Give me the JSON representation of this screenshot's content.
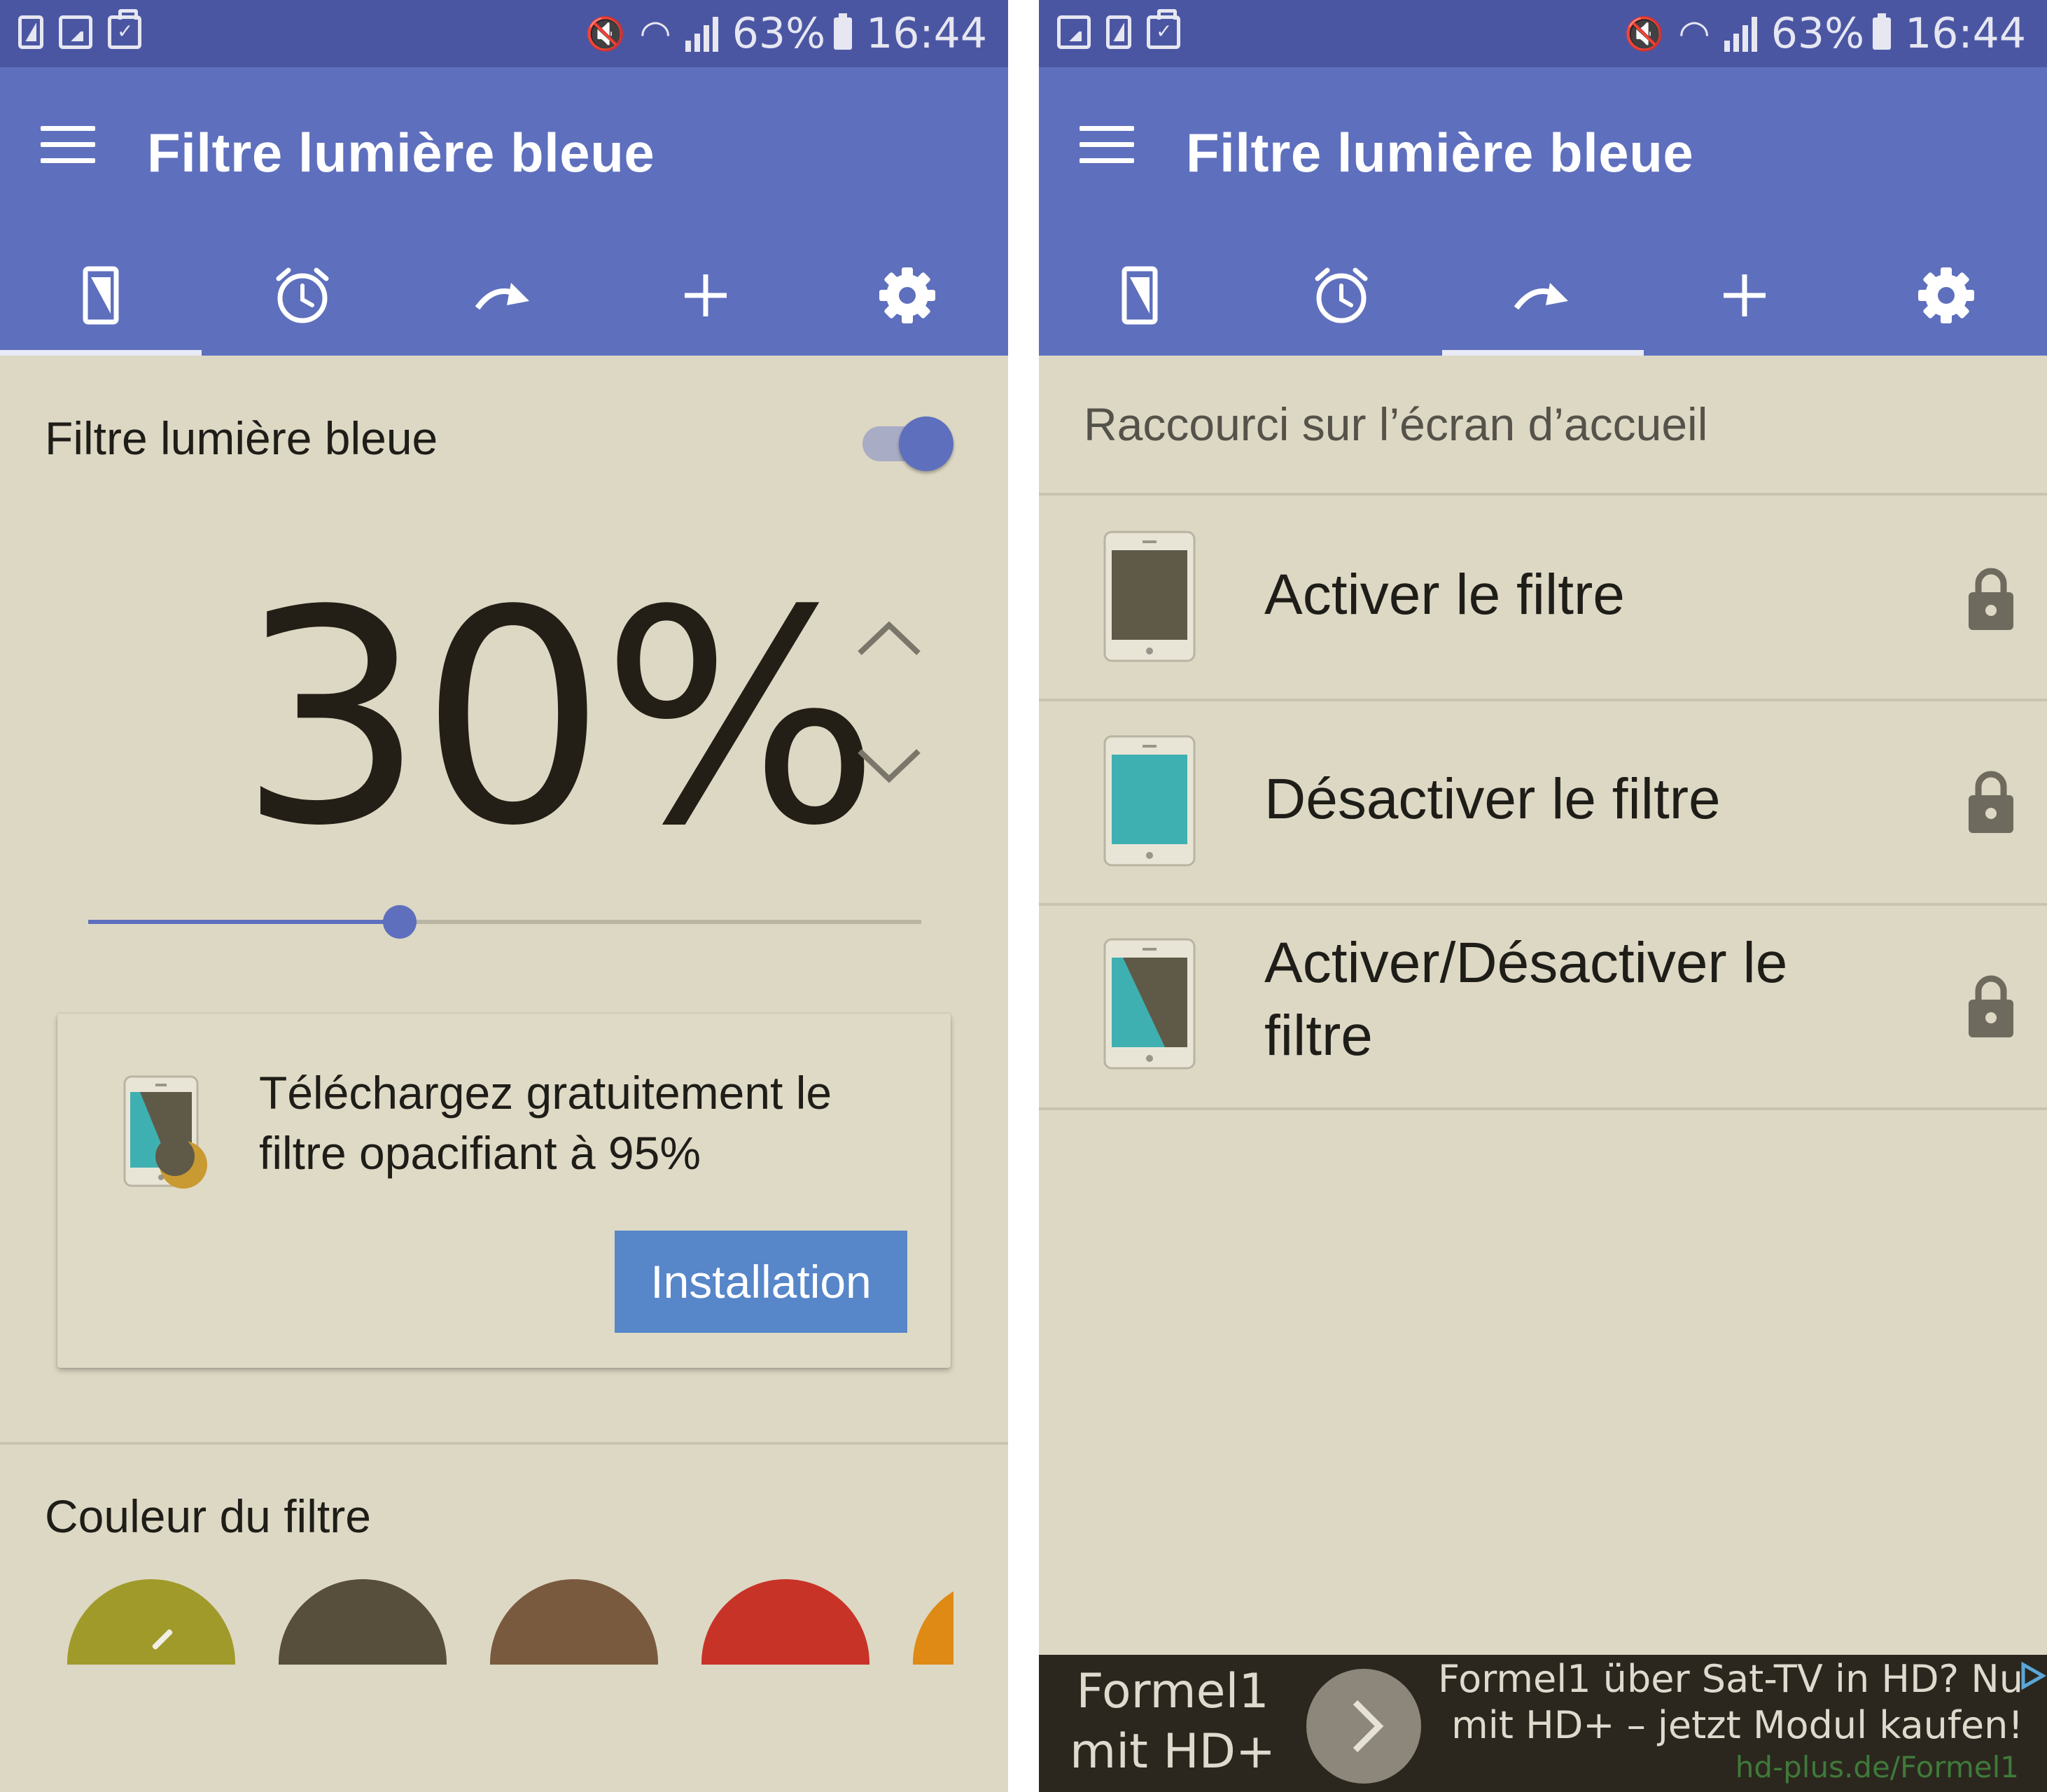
{
  "status_bar": {
    "battery": "63%",
    "time": "16:44"
  },
  "app": {
    "title": "Filtre lumière bleue",
    "tabs": [
      {
        "icon": "phone-filter-icon"
      },
      {
        "icon": "alarm-clock-icon"
      },
      {
        "icon": "redo-arrow-icon"
      },
      {
        "icon": "plus-icon"
      },
      {
        "icon": "gear-icon"
      }
    ]
  },
  "left_screen": {
    "active_tab": 0,
    "filter_toggle": {
      "label": "Filtre lumière bleue",
      "on": true
    },
    "opacity": {
      "value_label": "30%",
      "value": 30,
      "slider_fraction": 0.374
    },
    "promo": {
      "text": "Téléchargez gratuitement le filtre opacifiant à 95%",
      "button": "Installation"
    },
    "color_section": {
      "label": "Couleur du filtre",
      "colors": [
        "#a09a2a",
        "#574e3b",
        "#7a5a3f",
        "#c83328",
        "#de8a14"
      ],
      "selected": 0
    }
  },
  "right_screen": {
    "active_tab": 2,
    "section_header": "Raccourci sur l’écran d’accueil",
    "shortcuts": [
      {
        "label": "Activer le filtre",
        "locked": true
      },
      {
        "label": "Désactiver le filtre",
        "locked": true
      },
      {
        "label": "Activer/Désactiver le filtre",
        "locked": true
      }
    ],
    "ad": {
      "left_line1": "Formel1",
      "left_line2": "mit HD+ »",
      "right_line1": "Formel1 über Sat-TV in HD? Nu",
      "right_line2": "mit HD+ – jetzt Modul kaufen!",
      "url": "hd-plus.de/Formel1"
    }
  },
  "colors": {
    "status_bar": "#4b56a3",
    "app_bar": "#5e6fbd",
    "background": "#ddd8c4",
    "accent_button": "#5786c9"
  }
}
